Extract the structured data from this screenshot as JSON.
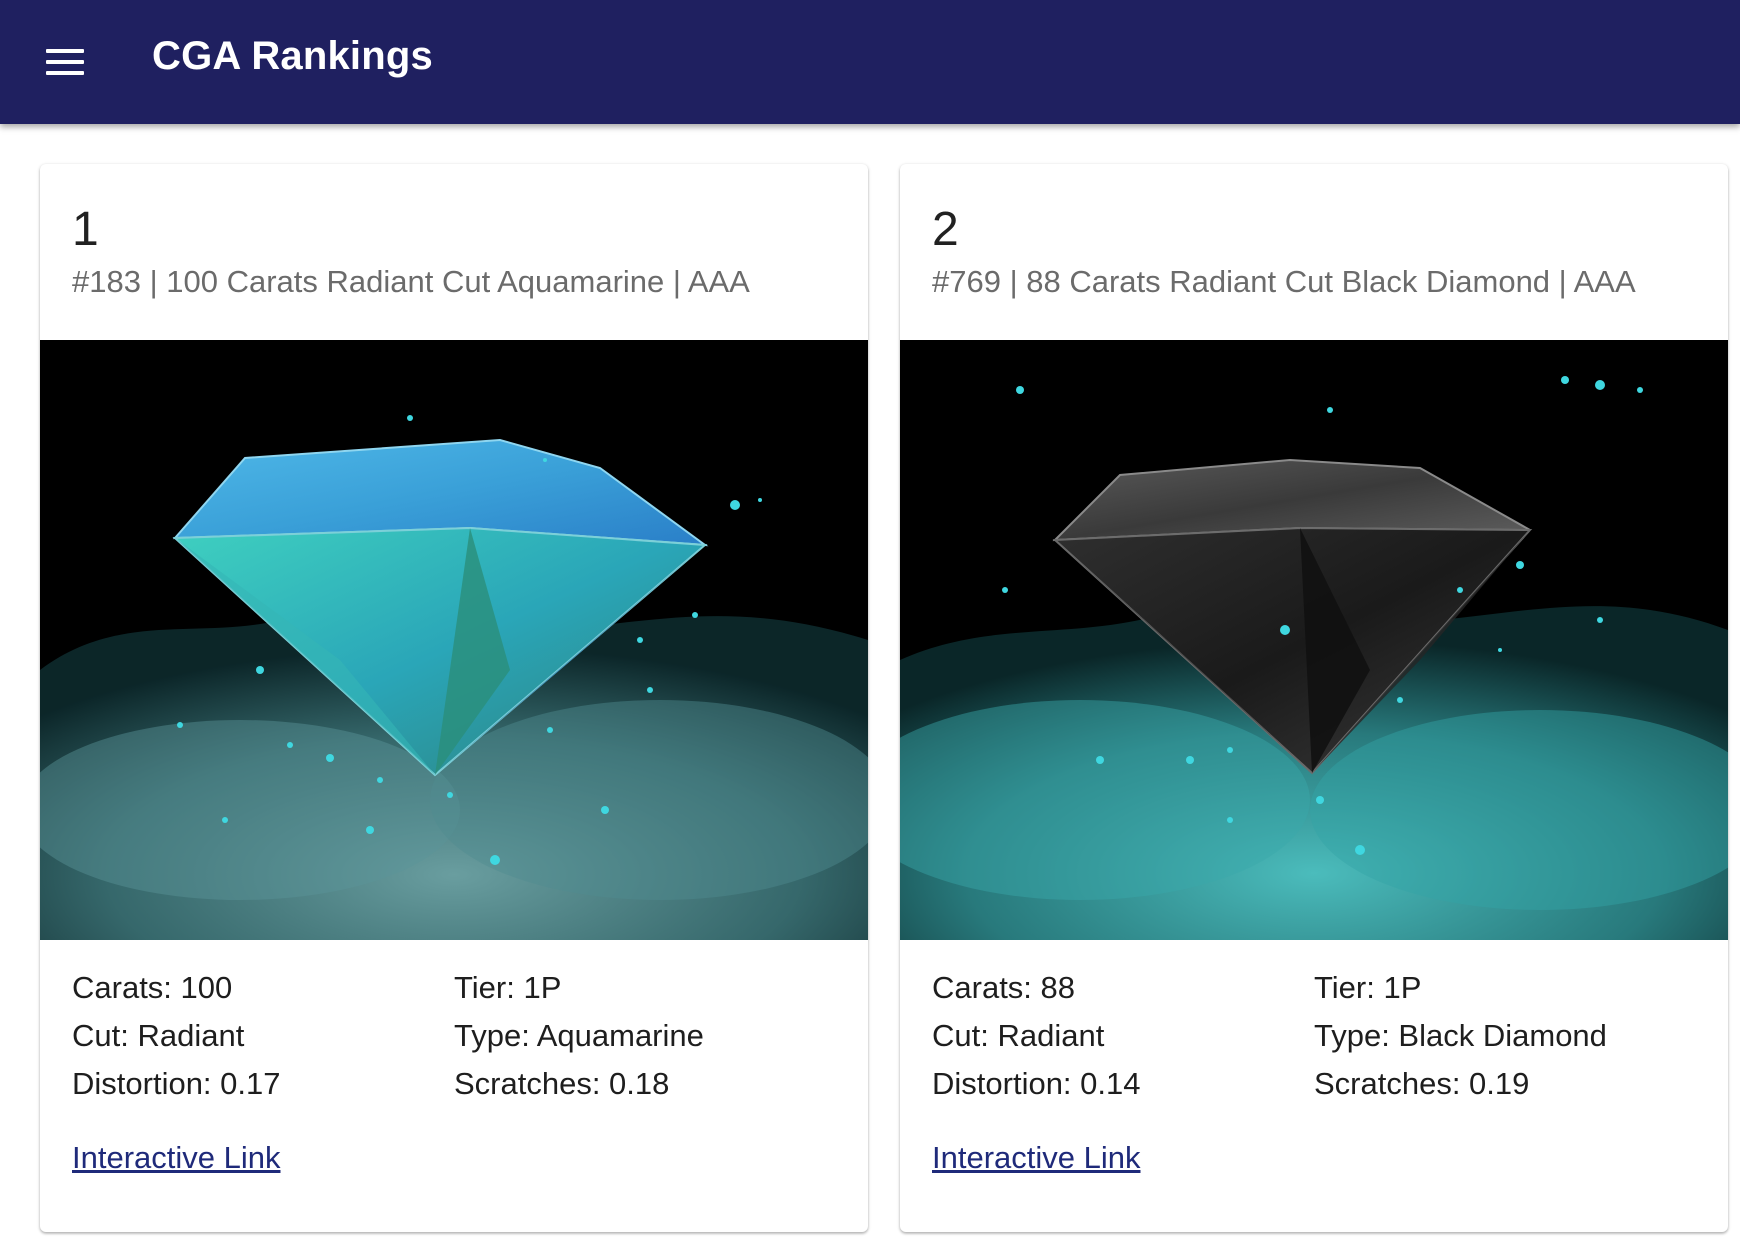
{
  "app": {
    "title": "CGA Rankings",
    "menu_icon": "hamburger-menu-icon",
    "bar_color": "#1f2060"
  },
  "cards": [
    {
      "rank": "1",
      "subtitle": "#183 | 100 Carats Radiant Cut Aquamarine | AAA",
      "image_description_icon": "gem-image-aquamarine",
      "attributes_left": [
        "Carats: 100",
        "Cut: Radiant",
        "Distortion: 0.17"
      ],
      "attributes_right": [
        "Tier: 1P",
        "Type: Aquamarine",
        "Scratches: 0.18"
      ],
      "link_label": "Interactive Link",
      "gem_color": "#3fb7c9"
    },
    {
      "rank": "2",
      "subtitle": "#769 | 88 Carats Radiant Cut Black Diamond | AAA",
      "image_description_icon": "gem-image-black-diamond",
      "attributes_left": [
        "Carats: 88",
        "Cut: Radiant",
        "Distortion: 0.14"
      ],
      "attributes_right": [
        "Tier: 1P",
        "Type: Black Diamond",
        "Scratches: 0.19"
      ],
      "link_label": "Interactive Link",
      "gem_color": "#2b2b2b"
    }
  ]
}
